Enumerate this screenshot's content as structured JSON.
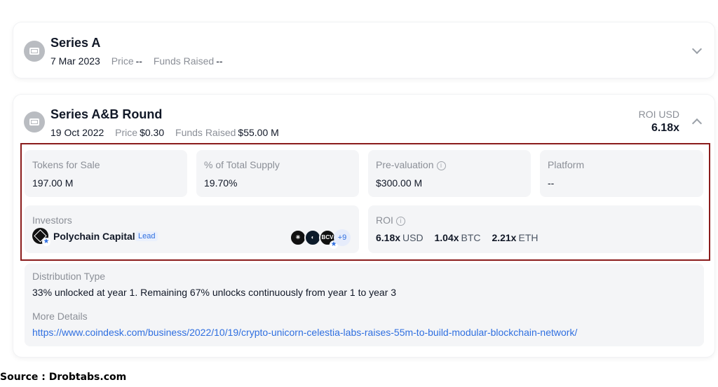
{
  "rounds": [
    {
      "title": "Series A",
      "date": "7 Mar 2023",
      "price_label": "Price",
      "price": "--",
      "funds_label": "Funds Raised",
      "funds": "--"
    },
    {
      "title": "Series A&B Round",
      "date": "19 Oct 2022",
      "price_label": "Price",
      "price": "$0.30",
      "funds_label": "Funds Raised",
      "funds": "$55.00 M",
      "roi_label": "ROI USD",
      "roi_value": "6.18x"
    }
  ],
  "details": {
    "tokens_for_sale": {
      "label": "Tokens for Sale",
      "value": "197.00 M"
    },
    "total_supply": {
      "label": "% of Total Supply",
      "value": "19.70%"
    },
    "pre_valuation": {
      "label": "Pre-valuation",
      "value": "$300.00 M"
    },
    "platform": {
      "label": "Platform",
      "value": "--"
    },
    "investors": {
      "label": "Investors",
      "lead_name": "Polychain Capital",
      "lead_badge": "Lead",
      "mini_logo_text": "BCV",
      "more_count": "+9"
    },
    "roi": {
      "label": "ROI",
      "usd_value": "6.18x",
      "usd_unit": "USD",
      "btc_value": "1.04x",
      "btc_unit": "BTC",
      "eth_value": "2.21x",
      "eth_unit": "ETH"
    }
  },
  "distribution": {
    "type_label": "Distribution Type",
    "type_value": "33% unlocked at year 1. Remaining 67% unlocks continuously from year 1 to year 3",
    "more_label": "More Details",
    "more_link": "https://www.coindesk.com/business/2022/10/19/crypto-unicorn-celestia-labs-raises-55m-to-build-modular-blockchain-network/"
  },
  "source_text": "Source : Drobtabs.com",
  "colors": {
    "accent": "#2f6fe0",
    "highlight_border": "#8b1c1c",
    "tile_bg": "#f4f5f7"
  },
  "icons": [
    "round-icon",
    "chevron-down-icon",
    "chevron-up-icon",
    "info-icon",
    "star-icon"
  ]
}
